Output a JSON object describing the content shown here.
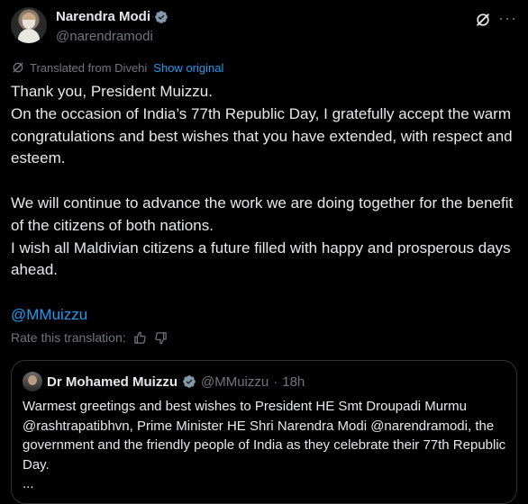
{
  "author": {
    "display_name": "Narendra Modi",
    "handle": "@narendramodi"
  },
  "translation": {
    "label": "Translated from Divehi",
    "show_original": "Show original",
    "rate_label": "Rate this translation:"
  },
  "post": {
    "line1": "Thank you, President Muizzu.",
    "line2": "On the occasion of India’s 77th Republic Day, I gratefully accept the warm congratulations and best wishes that you have extended, with respect and esteem.",
    "line3": "We will continue to advance the work we are doing together for the benefit of the citizens of both nations.",
    "line4": "I wish all Maldivian citizens a future filled with happy and prosperous days ahead.",
    "mention": "@MMuizzu"
  },
  "quoted": {
    "display_name": "Dr Mohamed Muizzu",
    "handle": "@MMuizzu",
    "separator": "·",
    "time": "18h",
    "text": "Warmest greetings and best wishes to President HE Smt Droupadi Murmu @rashtrapatibhvn, Prime Minister HE Shri Narendra Modi @narendramodi, the government and the friendly people of India as they celebrate their 77th Republic Day.",
    "ellipsis": "..."
  },
  "icons": {
    "verified": "verified-badge-icon",
    "grok": "grok-icon",
    "more": "more-icon",
    "translate": "translate-icon",
    "thumbs_up": "thumbs-up-icon",
    "thumbs_down": "thumbs-down-icon"
  },
  "colors": {
    "background": "#000000",
    "text": "#e7e9ea",
    "muted": "#71767b",
    "link": "#1d9bf0",
    "border": "#2f3336"
  }
}
